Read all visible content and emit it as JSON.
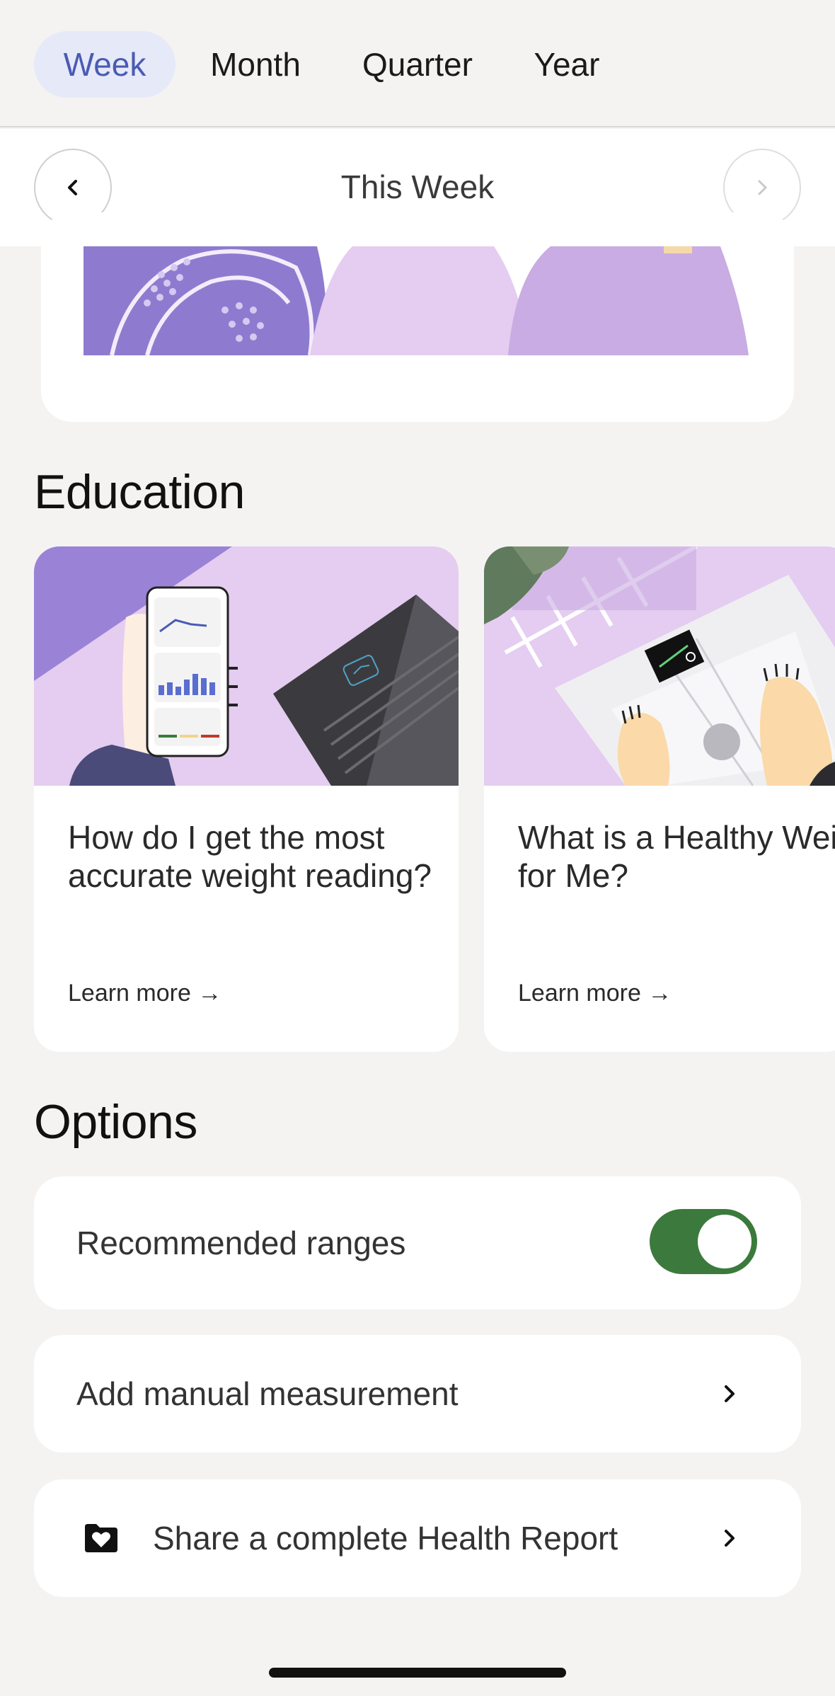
{
  "tabs": [
    "Week",
    "Month",
    "Quarter",
    "Year"
  ],
  "week_nav": {
    "label": "This Week"
  },
  "education": {
    "title": "Education",
    "cards": [
      {
        "title": "How do I get the most accurate weight reading?",
        "link": "Learn more →"
      },
      {
        "title": "What is a Healthy Weight for Me?",
        "link": "Learn more →"
      }
    ]
  },
  "options": {
    "title": "Options",
    "recommended_ranges": {
      "label": "Recommended ranges",
      "enabled": true
    },
    "manual_measurement": {
      "label": "Add manual measurement"
    },
    "share_report": {
      "label": "Share a complete Health Report"
    }
  },
  "colors": {
    "accent": "#4a5bb3",
    "tab_active_bg": "#e6e9f8",
    "toggle_on": "#3b7a3c",
    "illustration_purple": "#8e7bd0",
    "illustration_lilac": "#e4cdf0"
  },
  "icons": {
    "prev": "chevron-left-icon",
    "next": "chevron-right-icon",
    "row_chevron": "chevron-right-icon",
    "share": "folder-heart-icon"
  }
}
